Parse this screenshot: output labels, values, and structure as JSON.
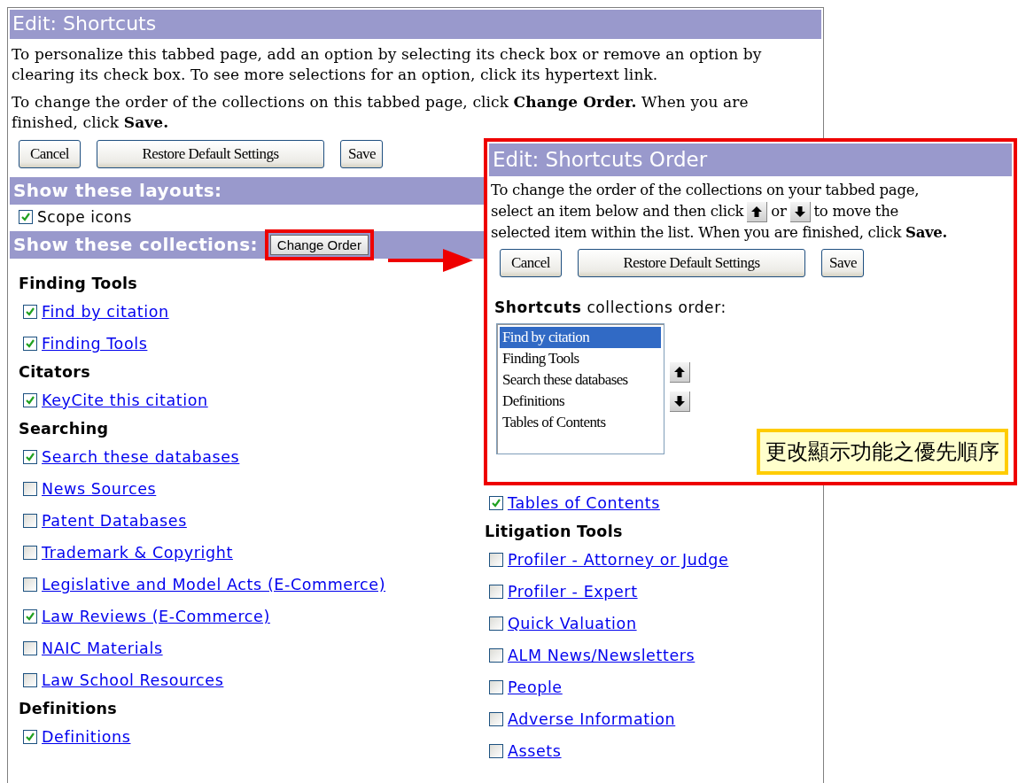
{
  "window": {
    "title": "Edit: Shortcuts"
  },
  "intro": [
    "To personalize this tabbed page, add an option by selecting its check box or remove an option by clearing its check box. To see more selections for an option, click its hypertext link.",
    "To change the order of the collections on this tabbed page, click **Change Order.** When you are finished, click **Save.**"
  ],
  "buttons": [
    "Cancel",
    "Restore Default Settings",
    "Save"
  ],
  "layouts": {
    "heading": "Show these layouts:",
    "items": [
      {
        "label": "Scope icons",
        "checked": true
      }
    ]
  },
  "collections": {
    "heading": "Show these collections:",
    "change_order_button": "Change Order",
    "columns": [
      [
        {
          "heading": "Finding Tools",
          "items": [
            {
              "label": "Find by citation",
              "checked": true
            },
            {
              "label": "Finding Tools",
              "checked": true
            }
          ]
        },
        {
          "heading": "Citators",
          "items": [
            {
              "label": "KeyCite this citation",
              "checked": true
            }
          ]
        },
        {
          "heading": "Searching",
          "items": [
            {
              "label": "Search these databases",
              "checked": true
            },
            {
              "label": "News Sources",
              "checked": false
            },
            {
              "label": "Patent Databases",
              "checked": false
            },
            {
              "label": "Trademark & Copyright",
              "checked": false
            },
            {
              "label": "Legislative and Model Acts (E-Commerce)",
              "checked": false
            },
            {
              "label": "Law Reviews (E-Commerce)",
              "checked": true
            },
            {
              "label": "NAIC Materials",
              "checked": false
            },
            {
              "label": "Law School Resources",
              "checked": false
            }
          ]
        },
        {
          "heading": "Definitions",
          "items": [
            {
              "label": "Definitions",
              "checked": true
            }
          ]
        }
      ],
      [
        {
          "items": [
            {
              "label": "Tables of Contents",
              "checked": true
            }
          ]
        },
        {
          "heading": "Litigation Tools",
          "items": [
            {
              "label": "Profiler - Attorney or Judge",
              "checked": false
            },
            {
              "label": "Profiler - Expert",
              "checked": false
            },
            {
              "label": "Quick Valuation",
              "checked": false
            },
            {
              "label": "ALM News/Newsletters",
              "checked": false
            },
            {
              "label": "People",
              "checked": false
            },
            {
              "label": "Adverse Information",
              "checked": false
            },
            {
              "label": "Assets",
              "checked": false
            }
          ]
        }
      ]
    ]
  },
  "order_dialog": {
    "title": "Edit: Shortcuts Order",
    "instructions": {
      "first_line": "To change the order of the collections on your tabbed page,",
      "before": "select an item below and then click",
      "between": "or",
      "after": "to move the",
      "last_line": "selected item within the list. When you are finished, click **Save.**"
    },
    "buttons": [
      "Cancel",
      "Restore Default Settings",
      "Save"
    ],
    "list_label": "**Shortcuts** collections order:",
    "list_items": [
      {
        "label": "Find by citation",
        "selected": true
      },
      {
        "label": "Finding Tools",
        "selected": false
      },
      {
        "label": "Search these databases",
        "selected": false
      },
      {
        "label": "Definitions",
        "selected": false
      },
      {
        "label": "Tables of Contents",
        "selected": false
      }
    ],
    "callout": "更改顯示功能之優先順序"
  }
}
